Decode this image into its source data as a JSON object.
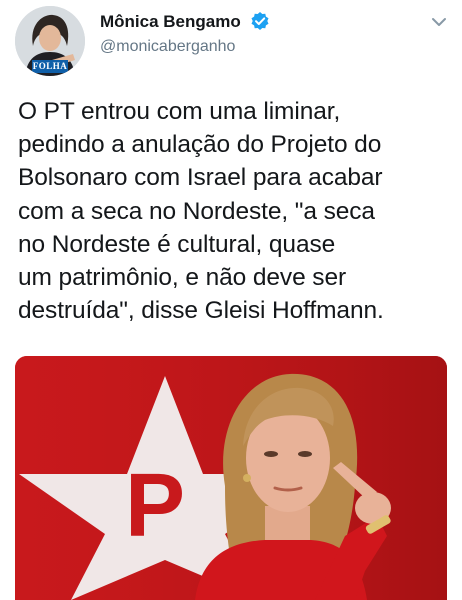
{
  "tweet": {
    "author": {
      "display_name": "Mônica Bengamo",
      "handle": "@monicaberganho",
      "avatar_badge": "FOLHA",
      "verified": true
    },
    "menu_icon": "chevron-down-icon",
    "text": "O PT entrou com uma liminar,\npedindo a anulação do Projeto do\nBolsonaro com Israel para acabar\ncom a seca no Nordeste, \"a seca\nno Nordeste é cultural, quase\num patrimônio, e não deve ser\ndestruída\", disse Gleisi Hoffmann.",
    "media": {
      "poster_letter": "P"
    }
  },
  "colors": {
    "verified": "#1da1f2",
    "media_red": "#c8191c",
    "star_white": "#f2f2f2"
  }
}
